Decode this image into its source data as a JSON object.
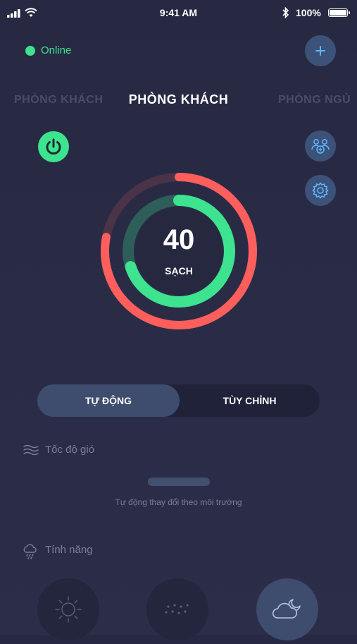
{
  "status_bar": {
    "time": "9:41 AM",
    "battery": "100%",
    "icons": [
      "signal-icon",
      "wifi-icon",
      "bluetooth-icon",
      "battery-icon"
    ]
  },
  "connection": {
    "status": "Online",
    "color": "#3de38f"
  },
  "rooms": {
    "left": "PHÒNG KHÁCH",
    "current": "PHÒNG KHÁCH",
    "right": "PHÒNG NGỦ"
  },
  "gauge": {
    "value": "40",
    "label": "SẠCH",
    "outer_fill_fraction": 0.78,
    "inner_fill_fraction": 0.7,
    "outer_color": "#ff5f5c",
    "inner_color": "#3de38f"
  },
  "mode_toggle": {
    "auto": "TỰ ĐỘNG",
    "custom": "TÙY CHỈNH",
    "selected": "auto"
  },
  "wind": {
    "label": "Tốc độ gió",
    "hint": "Tự động thay đổi theo môi trường",
    "icon": "wind-icon"
  },
  "features": {
    "label": "Tính năng",
    "icon": "weather-icon",
    "modes": [
      {
        "icon": "sun-icon",
        "active": false
      },
      {
        "icon": "dots-icon",
        "active": false
      },
      {
        "icon": "cloud-moon-icon",
        "active": true
      }
    ]
  },
  "colors": {
    "accent_green": "#3de38f",
    "accent_red": "#ff5f5c",
    "button_blue": "#3d5278",
    "icon_blue": "#5eb6ff",
    "background": "#282a44"
  }
}
